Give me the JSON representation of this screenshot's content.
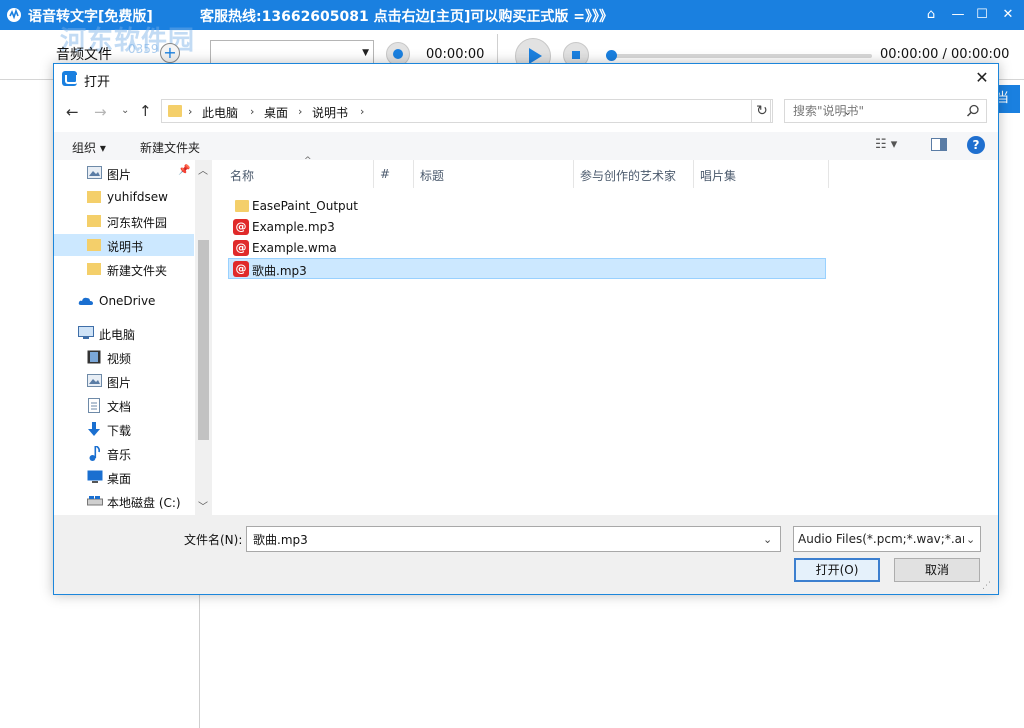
{
  "app": {
    "title": "语音转文字[免费版]",
    "hotline": "客服热线:13662605081  点击右边[主页]可以购买正式版 =》》》",
    "watermark": "河东软件园",
    "watermark_url": "0359",
    "audio_file_label": "音频文件",
    "record_time": "00:00:00",
    "play_time": "00:00:00 / 00:00:00",
    "playback_progress": 0,
    "right_button_label": "当",
    "accent_color": "#1a80e0"
  },
  "dialog": {
    "title": "打开",
    "breadcrumb": [
      "此电脑",
      "桌面",
      "说明书"
    ],
    "search_placeholder": "搜索\"说明书\"",
    "organize_label": "组织 ▾",
    "new_folder_label": "新建文件夹",
    "nav_items": [
      {
        "label": "图片",
        "icon": "pictures-icon",
        "pinned": true
      },
      {
        "label": "yuhifdsew",
        "icon": "folder-icon"
      },
      {
        "label": "河东软件园",
        "icon": "folder-icon"
      },
      {
        "label": "说明书",
        "icon": "folder-icon",
        "selected": true
      },
      {
        "label": "新建文件夹",
        "icon": "folder-icon"
      },
      {
        "label": "OneDrive",
        "icon": "onedrive-icon"
      },
      {
        "label": "此电脑",
        "icon": "this-pc-icon"
      },
      {
        "label": "视频",
        "icon": "videos-icon"
      },
      {
        "label": "图片",
        "icon": "pictures-icon"
      },
      {
        "label": "文档",
        "icon": "documents-icon"
      },
      {
        "label": "下载",
        "icon": "downloads-icon"
      },
      {
        "label": "音乐",
        "icon": "music-icon"
      },
      {
        "label": "桌面",
        "icon": "desktop-icon"
      },
      {
        "label": "本地磁盘 (C:)",
        "icon": "local-disk-icon"
      }
    ],
    "columns": [
      "名称",
      "#",
      "标题",
      "参与创作的艺术家",
      "唱片集"
    ],
    "files": [
      {
        "name": "EasePaint_Output",
        "type": "folder"
      },
      {
        "name": "Example.mp3",
        "type": "audio"
      },
      {
        "name": "Example.wma",
        "type": "audio"
      },
      {
        "name": "歌曲.mp3",
        "type": "audio",
        "selected": true
      }
    ],
    "filename_label": "文件名(N):",
    "filename_value": "歌曲.mp3",
    "filetype_value": "Audio Files(*.pcm;*.wav;*.amr",
    "open_label": "打开(O)",
    "cancel_label": "取消"
  }
}
